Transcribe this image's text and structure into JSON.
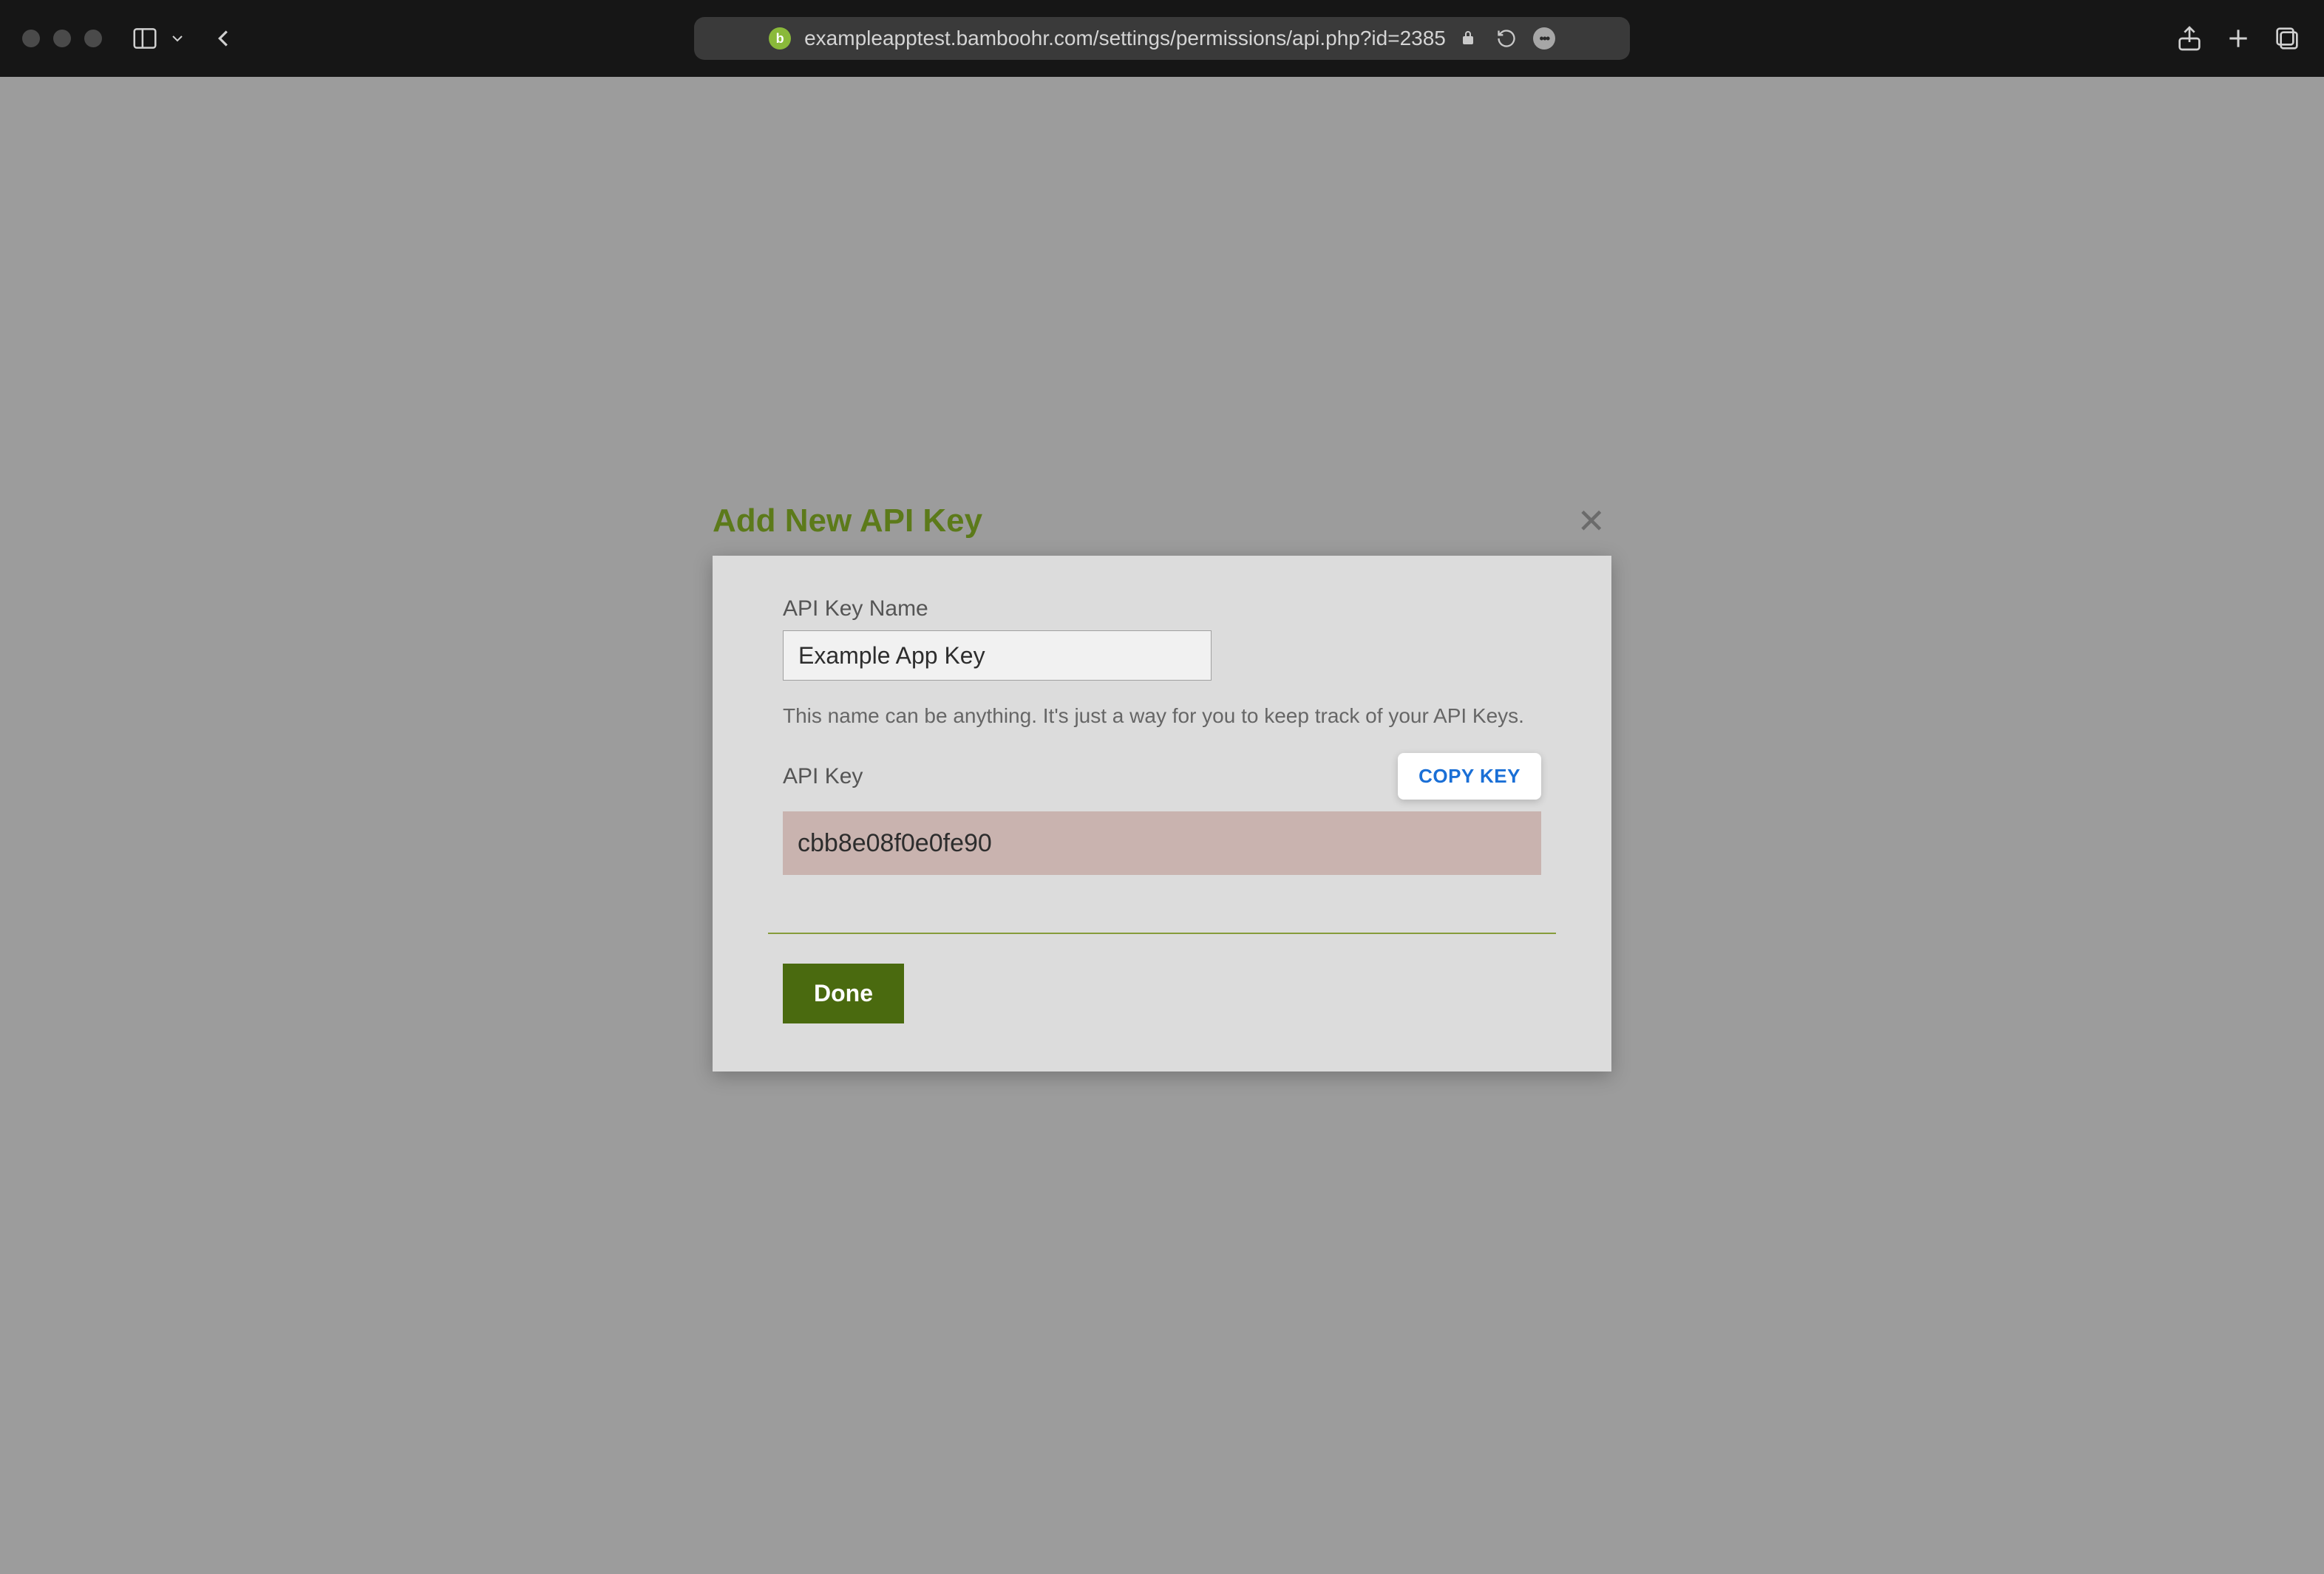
{
  "browser": {
    "url": "exampleapptest.bamboohr.com/settings/permissions/api.php?id=2385"
  },
  "modal": {
    "title": "Add New API Key",
    "name_field": {
      "label": "API Key Name",
      "value": "Example App Key",
      "help": "This name can be anything. It's just a way for you to keep track of your API Keys."
    },
    "key_field": {
      "label": "API Key",
      "copy_button": "COPY KEY",
      "value": "cbb8e08f0e0fe90"
    },
    "done_button": "Done"
  }
}
